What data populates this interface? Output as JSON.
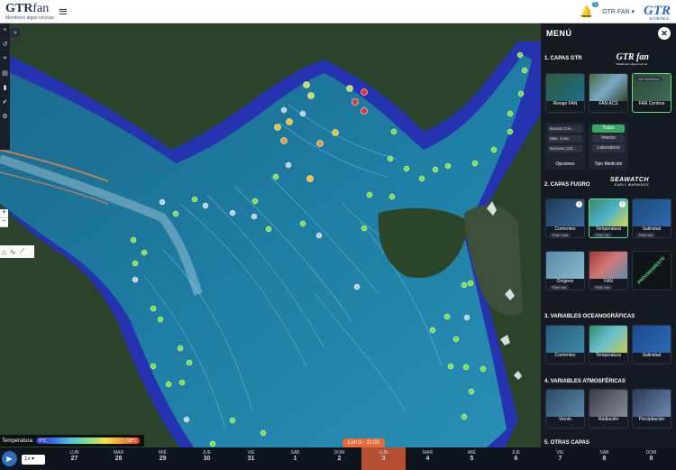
{
  "header": {
    "logo_main": "GTR",
    "logo_fan": "fan",
    "logo_sub": "Monitoreo algas nocivas",
    "notification_count": "1",
    "user_label": "GTR FAN ▾",
    "gtr_badge": "GTR",
    "gtr_badge_sub": "ACUICOLA"
  },
  "map_tools": {
    "expand_icon": "»",
    "left_icons": [
      "plus-icon",
      "history-icon",
      "location-icon",
      "layers-icon",
      "chart-icon",
      "check-icon",
      "settings-icon"
    ],
    "zoom": [
      "+",
      "−"
    ]
  },
  "temp_legend": {
    "label": "Temperatura:",
    "min": "8°C",
    "max": "18°C",
    "colors": [
      "#3d2fb8",
      "#3a6ee8",
      "#4bc4e6",
      "#7be28a",
      "#f1e640",
      "#f19b30",
      "#e53a2a"
    ]
  },
  "panel": {
    "title": "MENÚ",
    "close": "✕",
    "sections": [
      "1. CAPAS GTR",
      "2. CAPAS FUGRO",
      "3. VARIABLES OCEANOGRÁFICAS",
      "4. VARIABLES ATMOSFÉRICAS",
      "5. OTRAS CAPAS"
    ],
    "brand_gtr": "GTR fan",
    "brand_gtr_sub": "Monitoreo algas nocivas",
    "brand_sw": "SEAWATCH",
    "brand_sw_sub": "EARLY WARNINGS",
    "gtr_tiles": [
      "Riesgo FAN",
      "FAN ACS",
      "FAN Centros"
    ],
    "gtr_tile_label": "Ver Nombres",
    "options": {
      "rows": [
        "Buscar Cen...",
        "Máx. Conc",
        "Nocivas (10)..."
      ],
      "caption": "Opciones"
    },
    "tipo": {
      "rows": [
        "Todos",
        "Interno",
        "Laboratorio"
      ],
      "caption": "Tipo Medición"
    },
    "fugro_tiles": [
      {
        "label": "Corrientes",
        "sel": "Prof: 10m"
      },
      {
        "label": "Temperatura",
        "sel": "Prof: 0m"
      },
      {
        "label": "Salinidad",
        "sel": "Prof: 0m"
      },
      {
        "label": "Oxígeno",
        "sel": "Prof: 0m"
      },
      {
        "label": "FAN",
        "sel": "Prof: 0m"
      }
    ],
    "fugro_info": [
      "i",
      "i"
    ],
    "proximamente": "PRÓXIMAMENTE",
    "ocean_tiles": [
      "Corrientes",
      "Temperatura",
      "Salinidad"
    ],
    "atmos_tiles": [
      "Viento",
      "Radiación",
      "Precipitación"
    ]
  },
  "timeline": {
    "speed": "1x ▾",
    "current_label": "Lun 3 - 11:00",
    "days": [
      {
        "d": "LUN",
        "n": "27"
      },
      {
        "d": "MAR",
        "n": "28"
      },
      {
        "d": "MIÉ",
        "n": "29"
      },
      {
        "d": "JUE",
        "n": "30"
      },
      {
        "d": "VIE",
        "n": "31"
      },
      {
        "d": "SÁB",
        "n": "1"
      },
      {
        "d": "DOM",
        "n": "2"
      },
      {
        "d": "LUN",
        "n": "3"
      },
      {
        "d": "MAR",
        "n": "4"
      },
      {
        "d": "MIÉ",
        "n": "5"
      },
      {
        "d": "JUE",
        "n": "6"
      },
      {
        "d": "VIE",
        "n": "7"
      },
      {
        "d": "SÁB",
        "n": "8"
      },
      {
        "d": "DOM",
        "n": "9"
      }
    ]
  }
}
